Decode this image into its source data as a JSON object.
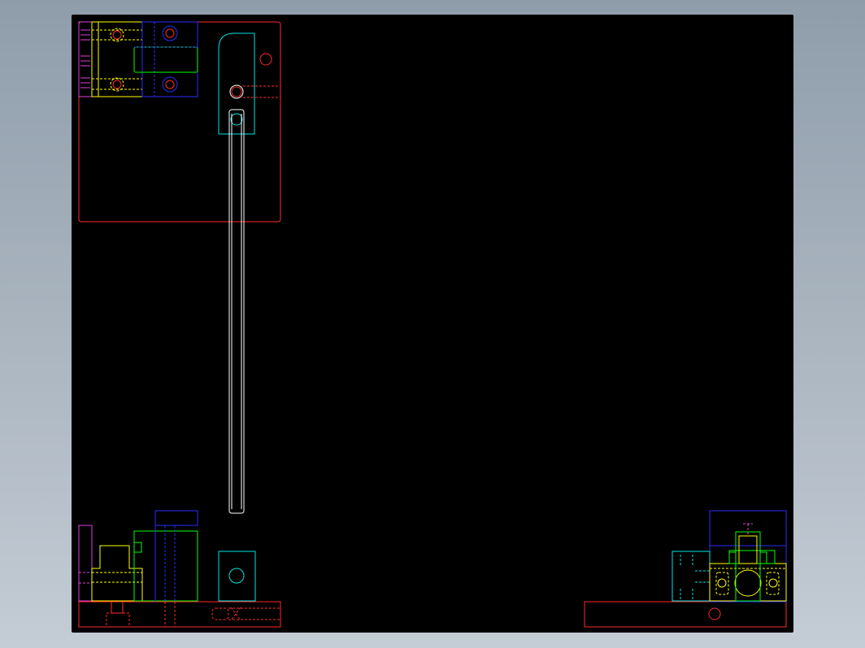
{
  "canvas": {
    "background": "#000000",
    "frame_background": "#a3afbb"
  },
  "layer_colors": {
    "red": "#ff2a2a",
    "blue": "#2b2bff",
    "yellow": "#ffff00",
    "green": "#00ff00",
    "cyan": "#00e5e5",
    "magenta": "#e040e0",
    "white": "#ffffff"
  },
  "views": [
    "top-left-plan-view",
    "bottom-left-front-view",
    "bottom-right-side-view"
  ]
}
